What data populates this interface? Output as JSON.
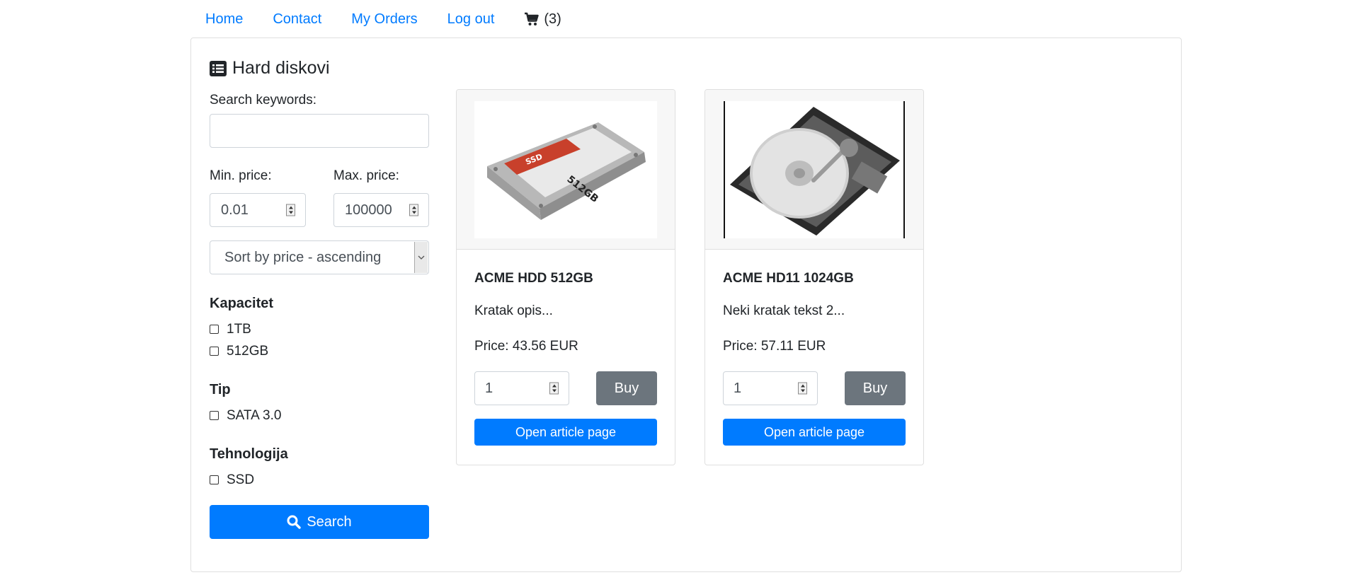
{
  "nav": {
    "home": "Home",
    "contact": "Contact",
    "orders": "My Orders",
    "logout": "Log out",
    "cart_count": "(3)",
    "cart_icon": "cart-icon"
  },
  "category": {
    "title": "Hard diskovi",
    "icon": "list-icon"
  },
  "filters": {
    "keywords_label": "Search keywords:",
    "keywords_value": "",
    "min_label": "Min. price:",
    "min_value": "0.01",
    "max_label": "Max. price:",
    "max_value": "100000",
    "sort_value": "Sort by price - ascending",
    "groups": [
      {
        "name": "Kapacitet",
        "options": [
          "1TB",
          "512GB"
        ]
      },
      {
        "name": "Tip",
        "options": [
          "SATA 3.0"
        ]
      },
      {
        "name": "Tehnologija",
        "options": [
          "SSD"
        ]
      }
    ],
    "search_button": "Search",
    "search_icon": "search-icon"
  },
  "products": [
    {
      "name": "ACME HDD 512GB",
      "description": "Kratak opis...",
      "price": "Price: 43.56 EUR",
      "quantity": "1",
      "buy_label": "Buy",
      "open_label": "Open article page"
    },
    {
      "name": "ACME HD11 1024GB",
      "description": "Neki kratak tekst 2...",
      "price": "Price: 57.11 EUR",
      "quantity": "1",
      "buy_label": "Buy",
      "open_label": "Open article page"
    }
  ],
  "colors": {
    "primary": "#007bff",
    "secondary": "#6c757d",
    "border": "#dfdfdf",
    "card_header": "#f7f7f7"
  }
}
